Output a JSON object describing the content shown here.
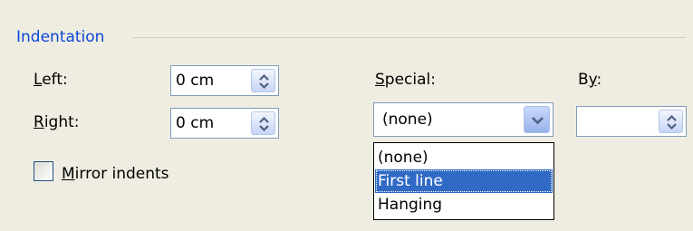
{
  "indentation": {
    "group_title": "Indentation",
    "left": {
      "label": "Left:",
      "mnemonic": "L",
      "rest": "eft:",
      "value": "0 cm"
    },
    "right": {
      "label": "Right:",
      "mnemonic": "R",
      "rest": "ight:",
      "value": "0 cm"
    },
    "special": {
      "label": "Special:",
      "mnemonic": "S",
      "rest": "pecial:",
      "selected": "(none)",
      "options": [
        "(none)",
        "First line",
        "Hanging"
      ],
      "highlighted_index": 1
    },
    "by": {
      "label": "By:",
      "pre": "B",
      "mnemonic": "y",
      "rest": ":",
      "value": ""
    },
    "mirror": {
      "label": "Mirror indents",
      "mnemonic": "M",
      "rest": "irror indents",
      "checked": false
    }
  },
  "icons": {
    "spin": "spin-arrows-icon",
    "dropdown": "chevron-down-icon"
  },
  "colors": {
    "group_title": "#0a46d5",
    "highlight": "#316ac5",
    "background": "#efede2"
  }
}
